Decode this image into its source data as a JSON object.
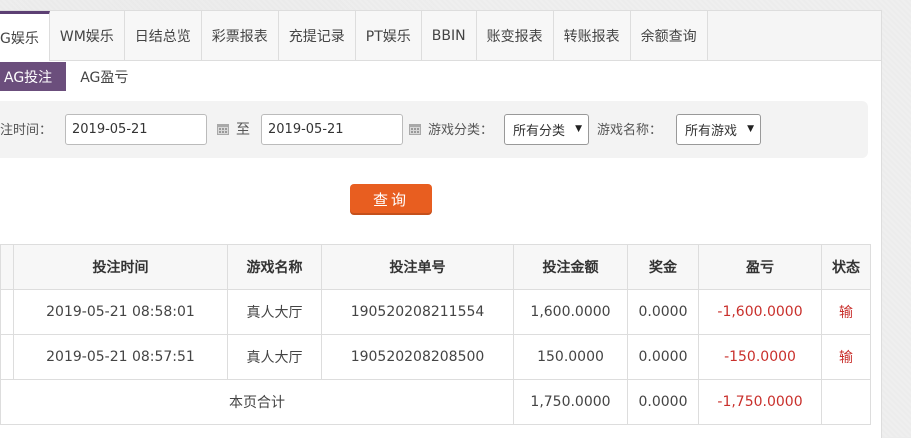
{
  "tabs": [
    {
      "label": "G娱乐",
      "active": true
    },
    {
      "label": "WM娱乐"
    },
    {
      "label": "日结总览"
    },
    {
      "label": "彩票报表"
    },
    {
      "label": "充提记录"
    },
    {
      "label": "PT娱乐"
    },
    {
      "label": "BBIN"
    },
    {
      "label": "账变报表"
    },
    {
      "label": "转账报表"
    },
    {
      "label": "余额查询"
    }
  ],
  "subtabs": {
    "active": "AG投注",
    "other": "AG盈亏"
  },
  "filter": {
    "time_label": "注时间：",
    "date_from": "2019-05-21",
    "to_label": "至",
    "date_to": "2019-05-21",
    "category_label": "游戏分类：",
    "category_value": "所有分类",
    "game_label": "游戏名称：",
    "game_value": "所有游戏"
  },
  "query_label": "查询",
  "table": {
    "headers": [
      "",
      "投注时间",
      "游戏名称",
      "投注单号",
      "投注金额",
      "奖金",
      "盈亏",
      "状态"
    ],
    "rows": [
      {
        "time": "2019-05-21 08:58:01",
        "game": "真人大厅",
        "order": "190520208211554",
        "amount": "1,600.0000",
        "bonus": "0.0000",
        "profit": "-1,600.0000",
        "status": "输"
      },
      {
        "time": "2019-05-21 08:57:51",
        "game": "真人大厅",
        "order": "190520208208500",
        "amount": "150.0000",
        "bonus": "0.0000",
        "profit": "-150.0000",
        "status": "输"
      }
    ],
    "total": {
      "label": "本页合计",
      "amount": "1,750.0000",
      "bonus": "0.0000",
      "profit": "-1,750.0000"
    }
  },
  "colors": {
    "accent": "#6b4e7c",
    "button": "#e85e20",
    "negative": "#c9302c"
  },
  "icons": {
    "calendar": "calendar-icon",
    "dropdown": "chevron-down-icon"
  }
}
